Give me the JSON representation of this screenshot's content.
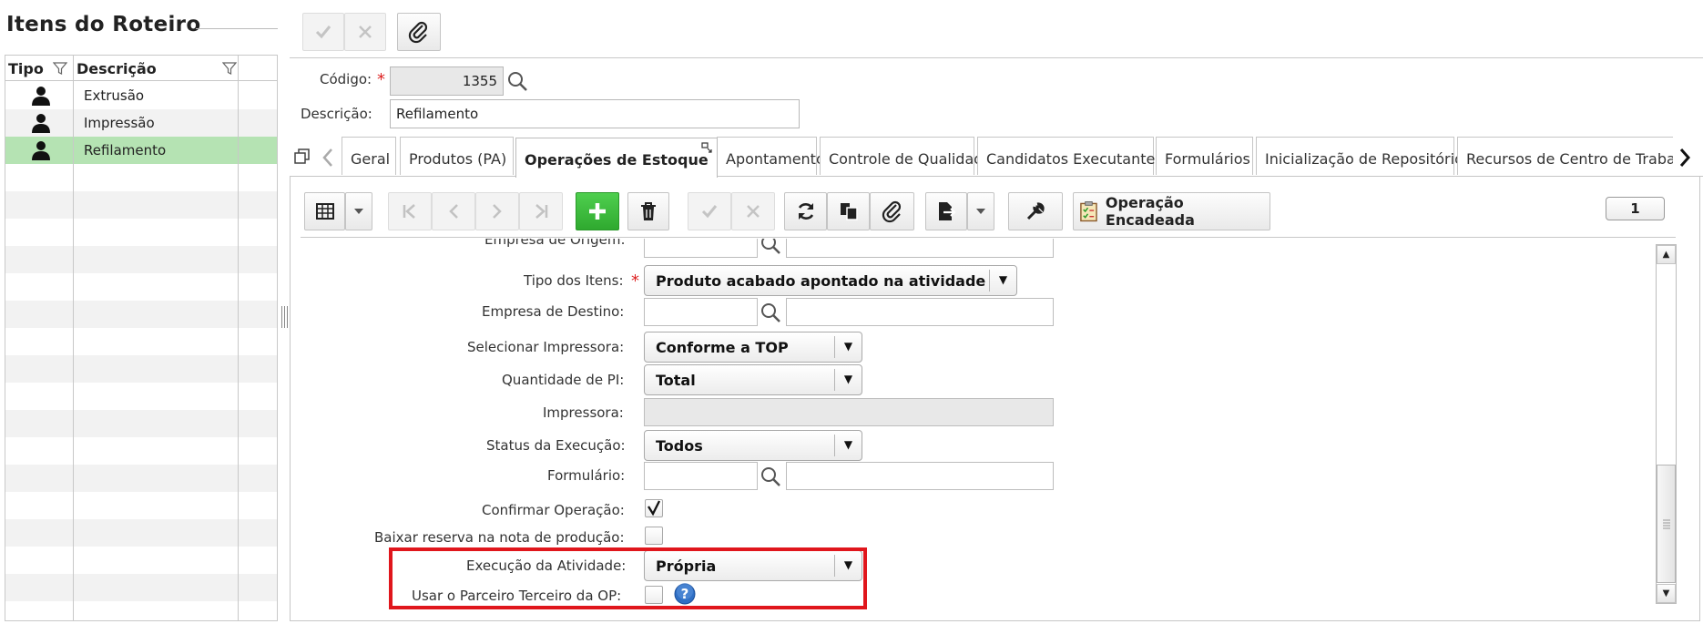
{
  "left_panel": {
    "title": "Itens do Roteiro",
    "columns": {
      "tipo": "Tipo",
      "descricao": "Descrição"
    },
    "rows": [
      {
        "descricao": "Extrusão",
        "selected": false
      },
      {
        "descricao": "Impressão",
        "selected": false
      },
      {
        "descricao": "Refilamento",
        "selected": true
      }
    ]
  },
  "header": {
    "codigo_label": "Código:",
    "codigo_value": "1355",
    "descricao_label": "Descrição:",
    "descricao_value": "Refilamento",
    "required_mark": "*"
  },
  "tabs": [
    {
      "label": "Geral",
      "active": false
    },
    {
      "label": "Produtos (PA)",
      "active": false
    },
    {
      "label": "Operações de Estoque",
      "active": true
    },
    {
      "label": "Apontamento",
      "active": false
    },
    {
      "label": "Controle de Qualidade",
      "active": false
    },
    {
      "label": "Candidatos Executantes",
      "active": false
    },
    {
      "label": "Formulários",
      "active": false
    },
    {
      "label": "Inicialização de Repositório",
      "active": false
    },
    {
      "label": "Recursos de Centro de Trabalho",
      "active": false
    }
  ],
  "inner_toolbar": {
    "chained_operation_label": "Operação Encadeada",
    "page_number": "1"
  },
  "form": {
    "empresa_origem_label": "Empresa de Origem:",
    "tipo_itens_label": "Tipo dos Itens:",
    "tipo_itens_value": "Produto acabado apontado na atividade",
    "empresa_destino_label": "Empresa de Destino:",
    "selecionar_impressora_label": "Selecionar Impressora:",
    "selecionar_impressora_value": "Conforme a TOP",
    "quantidade_pi_label": "Quantidade de PI:",
    "quantidade_pi_value": "Total",
    "impressora_label": "Impressora:",
    "status_execucao_label": "Status da Execução:",
    "status_execucao_value": "Todos",
    "formulario_label": "Formulário:",
    "confirmar_operacao_label": "Confirmar Operação:",
    "confirmar_operacao_checked": true,
    "baixar_reserva_label": "Baixar reserva na nota de produção:",
    "baixar_reserva_checked": false,
    "execucao_atividade_label": "Execução da Atividade:",
    "execucao_atividade_value": "Própria",
    "usar_parceiro_label": "Usar o Parceiro Terceiro da OP:",
    "usar_parceiro_checked": false
  },
  "colors": {
    "selected_row": "#b5e3b3",
    "add_button": "#3dbb3d",
    "highlight_border": "#e0161c",
    "required": "#d22222",
    "help_icon": "#2f6fc4"
  },
  "icons": [
    "check-icon",
    "close-icon",
    "paperclip-icon",
    "search-icon",
    "grid-icon",
    "first-icon",
    "prev-icon",
    "next-icon",
    "last-icon",
    "add-icon",
    "trash-icon",
    "refresh-icon",
    "copy-icon",
    "export-icon",
    "wrench-icon",
    "clipboard-icon",
    "help-icon",
    "person-icon",
    "filter-icon"
  ]
}
